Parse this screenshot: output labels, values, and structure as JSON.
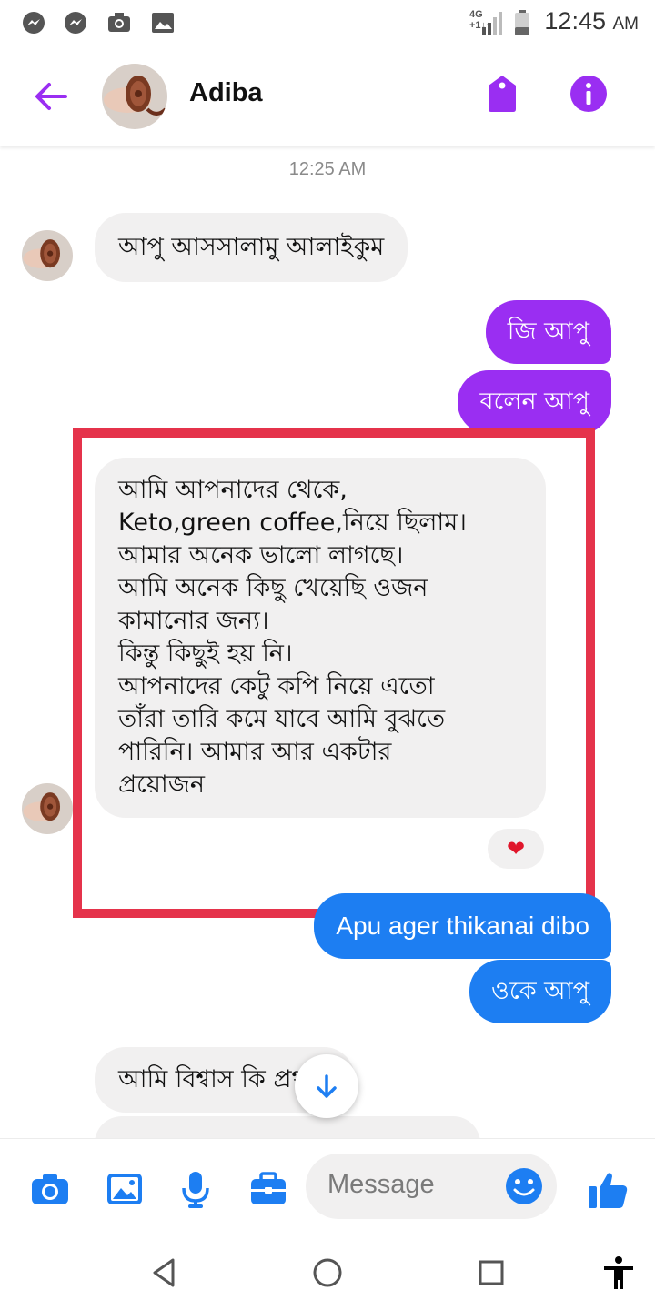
{
  "status_bar": {
    "time": "12:45",
    "ampm": "AM",
    "network_top": "4G",
    "network_bottom": "+1↓↑",
    "icons": [
      "messenger-icon",
      "messenger-icon",
      "camera-icon",
      "gallery-icon",
      "signal-icon",
      "battery-icon"
    ]
  },
  "header": {
    "contact_name": "Adiba",
    "icons": [
      "back-arrow-icon",
      "tag-icon",
      "info-icon"
    ]
  },
  "chat": {
    "timestamp": "12:25 AM",
    "messages": [
      {
        "direction": "in",
        "text": "আপু আসসালামু আলাইকুম"
      },
      {
        "direction": "out",
        "text": "জি আপু"
      },
      {
        "direction": "out",
        "text": "বলেন আপু"
      },
      {
        "direction": "in",
        "lines": [
          "আমি আপনাদের থেকে,",
          "Keto,green coffee,নিয়ে ছিলাম।",
          "আমার অনেক ভালো লাগছে।",
          "আমি অনেক কিছু খেয়েছি ওজন",
          "কামানোর জন্য।",
          "কিন্তু কিছুই হয় নি।",
          "আপনাদের কেটু কপি নিয়ে এতো",
          "তাঁরা তারি কমে যাবে আমি বুঝতে",
          "পারিনি। আমার আর একটার",
          "প্রয়োজন"
        ],
        "reaction": "❤"
      },
      {
        "direction": "out",
        "text": "Apu ager thikanai dibo"
      },
      {
        "direction": "out",
        "text": "ওকে আপু"
      },
      {
        "direction": "in",
        "text": "আমি বিশ্বাস কি প্রথমে"
      }
    ]
  },
  "composer": {
    "placeholder": "Message",
    "icons": [
      "camera-icon",
      "gallery-icon",
      "microphone-icon",
      "briefcase-icon",
      "emoji-icon",
      "thumbs-up-icon"
    ]
  },
  "colors": {
    "accent_purple": "#9a2ef2",
    "accent_blue": "#1d7ef2",
    "incoming_bubble": "#f1f0f0",
    "highlight_border": "#e5334b"
  }
}
